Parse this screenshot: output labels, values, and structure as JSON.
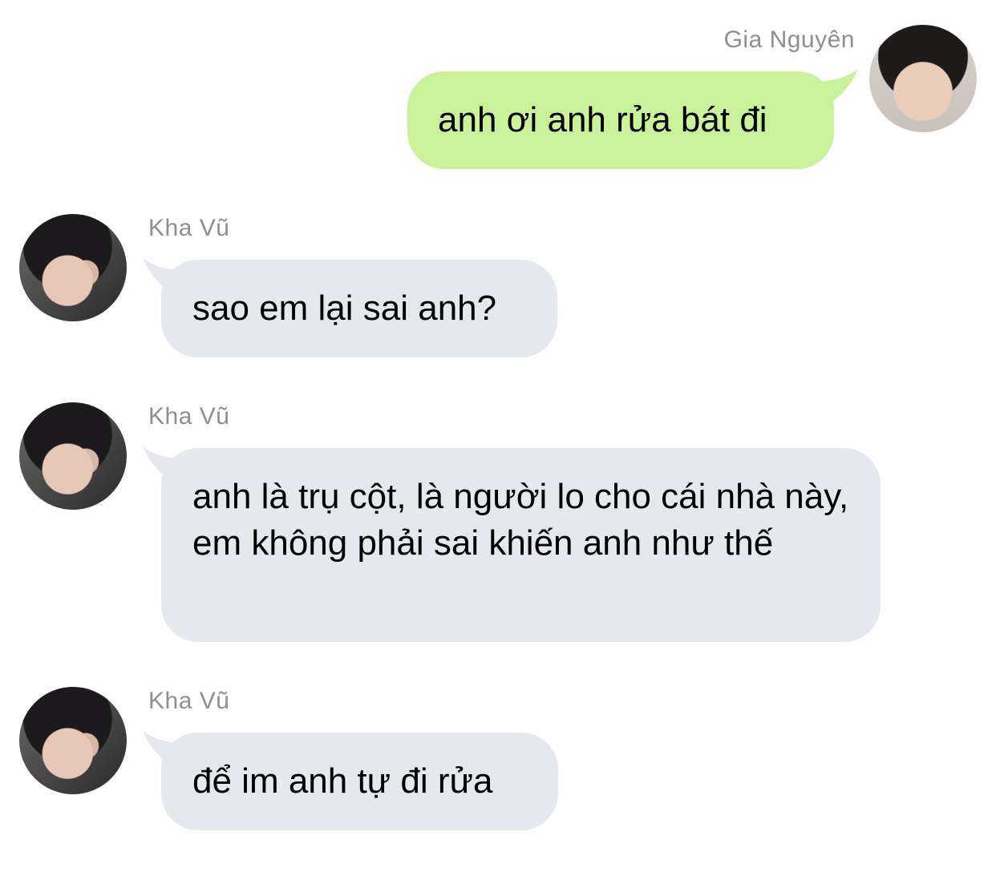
{
  "messages": [
    {
      "sender": "Gia Nguyên",
      "text": "anh ơi anh rửa bát đi",
      "direction": "outgoing"
    },
    {
      "sender": "Kha Vũ",
      "text": "sao em lại sai anh?",
      "direction": "incoming"
    },
    {
      "sender": "Kha Vũ",
      "text": "anh là trụ cột, là người lo cho cái nhà này, em không phải sai khiến anh như thế",
      "direction": "incoming"
    },
    {
      "sender": "Kha Vũ",
      "text": "để im anh tự đi rửa",
      "direction": "incoming"
    }
  ],
  "colors": {
    "outgoing_bubble": "#c9f29a",
    "incoming_bubble": "#e5e8ec",
    "sender_name": "#8e8e93",
    "background": "#ffffff"
  }
}
